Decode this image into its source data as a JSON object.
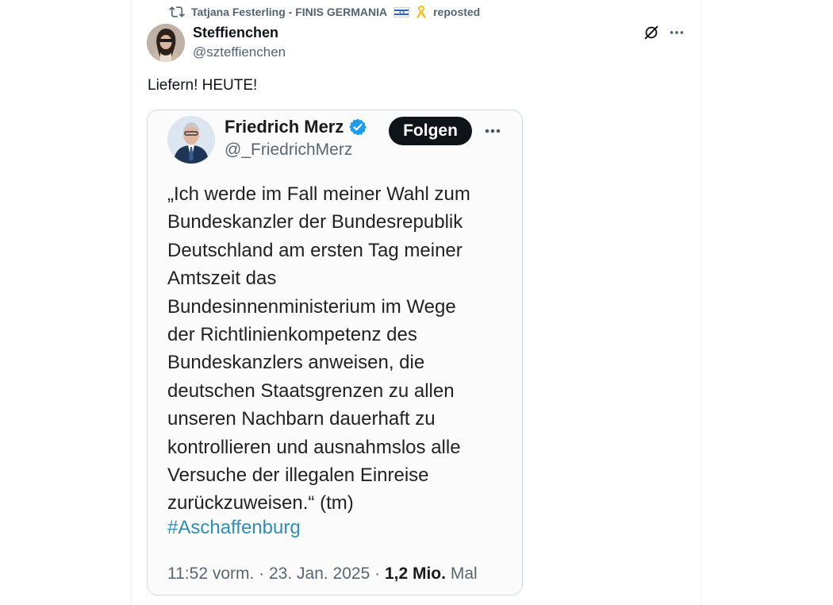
{
  "repost": {
    "reposter": "Tatjana Festerling - FINIS GERMANIA",
    "label": "reposted"
  },
  "post": {
    "author_name": "Steffienchen",
    "author_handle": "@szteffienchen",
    "text": "Liefern! HEUTE!"
  },
  "embedded_post": {
    "author_name": "Friedrich Merz",
    "author_handle": "@_FriedrichMerz",
    "follow_label": "Folgen",
    "quote_lines": [
      "„Ich werde im Fall meiner Wahl zum",
      "Bundeskanzler der Bundesrepublik",
      "Deutschland am ersten Tag meiner",
      "Amtszeit das",
      "Bundesinnenministerium im Wege",
      "der Richtlinienkompetenz des",
      "Bundeskanzlers anweisen, die",
      "deutschen Staatsgrenzen zu allen",
      "unseren Nachbarn dauerhaft zu",
      "kontrollieren und ausnahmslos alle",
      "Versuche der illegalen Einreise",
      "zurückzuweisen.“ (tm)"
    ],
    "hashtag": "#Aschaffenburg",
    "time": "11:52 vorm.",
    "date": "23. Jan. 2025",
    "views_count": "1,2 Mio.",
    "views_label": "Mal"
  },
  "colors": {
    "text_primary": "#0f1419",
    "text_secondary": "#536471",
    "hashtag": "#2f8fb6",
    "verified": "#1d9bf0",
    "follow_button": "#0f1419"
  },
  "icons": [
    "repost-icon",
    "israel-flag-icon",
    "yellow-ribbon-icon",
    "grok-icon",
    "more-icon",
    "verified-badge-icon"
  ]
}
